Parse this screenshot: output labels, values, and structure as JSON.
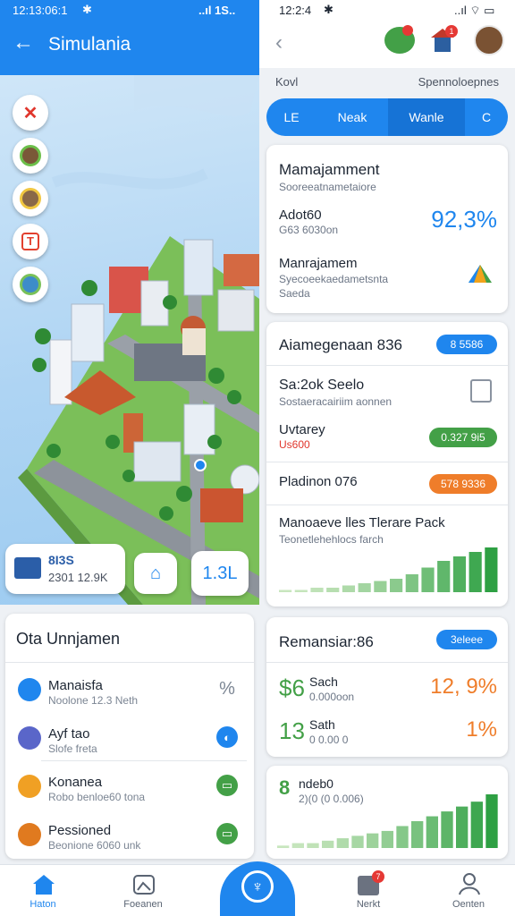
{
  "colors": {
    "primary": "#1f86ee",
    "green": "#43a047",
    "orange": "#ef7d2a",
    "card": "#ffffff"
  },
  "left": {
    "status": {
      "time": "12:13:06:1",
      "signal": "..ıl 1S..",
      "bt_icon": "bluetooth-icon"
    },
    "header": {
      "title": "Simulania",
      "back_icon": "arrow-left-icon"
    },
    "map_buttons": [
      {
        "name": "close-x-icon"
      },
      {
        "name": "avatar-pin-icon"
      },
      {
        "name": "profile-pin-icon"
      },
      {
        "name": "red-t-icon"
      },
      {
        "name": "person-group-icon"
      }
    ],
    "map_cards": {
      "info_title": "8I3S",
      "info_sub": "2301 12.9K",
      "building_icon": "building-icon",
      "value": "1.3L"
    },
    "panel": {
      "title": "Ota Unnjamen",
      "rows": [
        {
          "title": "Manaisfa",
          "sub": "Noolone 12.3 Neth",
          "right": "%"
        },
        {
          "title": "Ayf tao",
          "sub": "Slofe freta"
        },
        {
          "title": "Konanea",
          "sub": "Robo benloe60 tona"
        },
        {
          "title": "Pessioned",
          "sub": "Beonione 6060 unk"
        }
      ]
    }
  },
  "right": {
    "status": {
      "time": "12:2:4",
      "icons": "..ıl ⌔ ▭"
    },
    "header": {
      "back_icon": "chevron-left-icon",
      "badge_count": "1"
    },
    "sub_header": {
      "left": "Kovl",
      "right": "Spennoloepnes"
    },
    "segment": {
      "items": [
        "LE",
        "Neak",
        "Wanle",
        "C"
      ]
    },
    "card1": {
      "title": "Mamajamment",
      "sub": "Sooreeatnametaiore",
      "metric_title": "Adot60",
      "metric_sub": "G63 6030on",
      "metric_value": "92,3%",
      "row2_title": "Manrajamem",
      "row2_sub": "Syecoeekaedametsnta",
      "row2_sub2": "Saeda"
    },
    "card2": {
      "title": "Aiamegenaan 836",
      "pill1": "8 5586",
      "row1_title": "Sa:2ok Seelo",
      "row1_sub": "Sostaeracairiim aonnen",
      "row2_title": "Uvtarey",
      "row2_sub": "Us600",
      "pill2": "0.327 9i5",
      "row3_title": "Pladinon 076",
      "pill3": "578 9336",
      "chart_title": "Manoaeve lles Tlerare Pack",
      "chart_sub": "Teonetlehehlocs farch"
    },
    "card3": {
      "title": "Remansiar:86",
      "pill": "3eleee",
      "row1_big": "$6",
      "row1_title": "Sach",
      "row1_sub": "0.000oon",
      "row1_value": "12, 9%",
      "row2_big": "13",
      "row2_title": "Sath",
      "row2_sub": "0 0.00 0",
      "row2_value": "1%"
    },
    "card4": {
      "icon_label": "8",
      "title": "ndeb0",
      "sub": "2)(0 (0 0.006)"
    }
  },
  "nav": [
    {
      "label": "Haton",
      "icon": "home-icon"
    },
    {
      "label": "Foeanen",
      "icon": "image-icon"
    },
    {
      "label": "",
      "icon": "tree-icon"
    },
    {
      "label": "Nerkt",
      "icon": "chat-icon",
      "badge": "7"
    },
    {
      "label": "Oenten",
      "icon": "person-icon"
    }
  ],
  "chart_data": [
    {
      "type": "bar",
      "series": [
        {
          "values": [
            1,
            1,
            2,
            2,
            3,
            4,
            5,
            6,
            8,
            11,
            14,
            16,
            18,
            20
          ]
        }
      ]
    },
    {
      "type": "bar",
      "series": [
        {
          "values": [
            1,
            2,
            2,
            3,
            4,
            5,
            6,
            7,
            9,
            11,
            13,
            15,
            17,
            19,
            22
          ]
        }
      ]
    }
  ]
}
